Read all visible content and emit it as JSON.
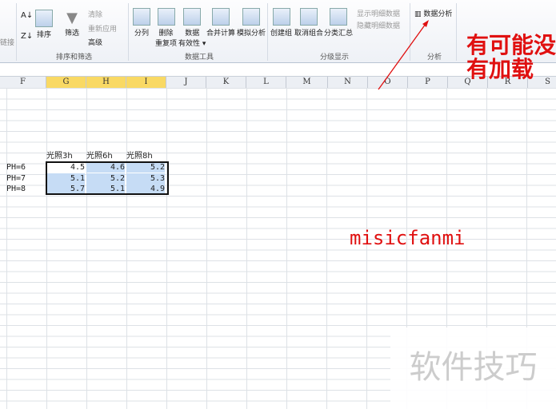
{
  "ribbon": {
    "links_label": "链接",
    "sort_filter": {
      "sort": "排序",
      "filter": "筛选",
      "clear": "清除",
      "reapply": "重新应用",
      "advanced": "高级",
      "group": "排序和筛选"
    },
    "data_tools": {
      "text_to_columns": "分列",
      "remove_dup": "删除\n重复项",
      "validation": "数据\n有效性 ▾",
      "consolidate": "合并计算",
      "what_if": "模拟分析",
      "group": "数据工具"
    },
    "outline": {
      "group_btn": "创建组",
      "ungroup": "取消组合",
      "subtotal": "分类汇总",
      "show_detail": "显示明细数据",
      "hide_detail": "隐藏明细数据",
      "group": "分级显示"
    },
    "analysis": {
      "data_analysis": "数据分析",
      "group": "分析"
    }
  },
  "columns": [
    "F",
    "G",
    "H",
    "I",
    "J",
    "K",
    "L",
    "M",
    "N",
    "O",
    "P",
    "Q",
    "R",
    "S"
  ],
  "selected_columns": [
    "G",
    "H",
    "I"
  ],
  "table": {
    "headers": [
      "光照3h",
      "光照6h",
      "光照8h"
    ],
    "rows": [
      {
        "label": "PH=6",
        "values": [
          "4.5",
          "4.6",
          "5.2"
        ]
      },
      {
        "label": "PH=7",
        "values": [
          "5.1",
          "5.2",
          "5.3"
        ]
      },
      {
        "label": "PH=8",
        "values": [
          "5.7",
          "5.1",
          "4.9"
        ]
      }
    ]
  },
  "annotation": "有可能没\n有加载",
  "watermark": "misicfanmi",
  "watermark2": "软件技巧",
  "colors": {
    "annotation": "#e01010",
    "selection": "#c6dcf5",
    "col_header_selected": "#f9d964"
  }
}
